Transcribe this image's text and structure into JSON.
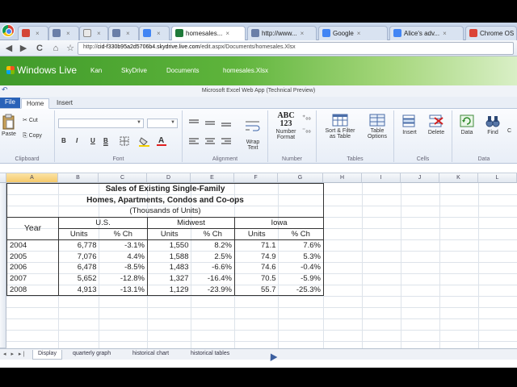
{
  "browser": {
    "tabs": [
      {
        "label": "",
        "color": "#d44638"
      },
      {
        "label": "",
        "color": "#6a7fa8"
      },
      {
        "label": "",
        "color": "#e9e9e9"
      },
      {
        "label": "",
        "color": "#6a7fa8"
      },
      {
        "label": "",
        "color": "#4285f4"
      },
      {
        "label": "homesales...",
        "color": "#1f7a3a"
      },
      {
        "label": "http://www...",
        "color": "#6a7fa8"
      },
      {
        "label": "Google",
        "color": "#4285f4"
      },
      {
        "label": "Alice's adv...",
        "color": "#4285f4"
      },
      {
        "label": "Chrome OS",
        "color": "#db4437"
      }
    ],
    "tab_close": "×",
    "back": "◀",
    "forward": "▶",
    "reload": "C",
    "home": "⌂",
    "star": "☆",
    "url_prefix": "http://",
    "url_domain": "cid-f330b95a2d5706b4.skydrive.live.com",
    "url_path": "/edit.aspx/Documents/homesales.Xlsx"
  },
  "live_header": {
    "brand": "Windows Live",
    "user": "Kan",
    "skydrive": "SkyDrive",
    "documents": "Documents",
    "file": "homesales.Xlsx"
  },
  "app_title": "Microsoft Excel Web App (Technical Preview)",
  "ribbon_tabs": {
    "file": "File",
    "home": "Home",
    "insert": "Insert"
  },
  "ribbon": {
    "paste": "Paste",
    "cut": "Cut",
    "copy": "Copy",
    "clipboard": "Clipboard",
    "font_group": "Font",
    "bold": "B",
    "italic": "I",
    "underline": "U",
    "dunderline": "B",
    "alignment": "Alignment",
    "wrap": "Wrap\nText",
    "number_format": "Number\nFormat",
    "number": "Number",
    "number_icon": "ABC\n123",
    "sort_filter": "Sort & Filter\nas Table",
    "table_options": "Table\nOptions",
    "tables": "Tables",
    "insert": "Insert",
    "delete": "Delete",
    "cells": "Cells",
    "data": "Data",
    "find": "Find",
    "data_group": "Data",
    "last": "C"
  },
  "columns": [
    "A",
    "B",
    "C",
    "D",
    "E",
    "F",
    "G",
    "H",
    "I",
    "J",
    "K",
    "L"
  ],
  "table": {
    "title1": "Sales of Existing Single-Family",
    "title2": "Homes, Apartments, Condos and Co-ops",
    "title3": "(Thousands of Units)",
    "year_label": "Year",
    "regions": [
      "U.S.",
      "Midwest",
      "Iowa"
    ],
    "units_label": "Units",
    "pct_label": "% Ch",
    "rows": [
      {
        "year": "2004",
        "us_units": "6,778",
        "us_pct": "-3.1%",
        "mw_units": "1,550",
        "mw_pct": "8.2%",
        "ia_units": "71.1",
        "ia_pct": "7.6%"
      },
      {
        "year": "2005",
        "us_units": "7,076",
        "us_pct": "4.4%",
        "mw_units": "1,588",
        "mw_pct": "2.5%",
        "ia_units": "74.9",
        "ia_pct": "5.3%"
      },
      {
        "year": "2006",
        "us_units": "6,478",
        "us_pct": "-8.5%",
        "mw_units": "1,483",
        "mw_pct": "-6.6%",
        "ia_units": "74.6",
        "ia_pct": "-0.4%"
      },
      {
        "year": "2007",
        "us_units": "5,652",
        "us_pct": "-12.8%",
        "mw_units": "1,327",
        "mw_pct": "-16.4%",
        "ia_units": "70.5",
        "ia_pct": "-5.9%"
      },
      {
        "year": "2008",
        "us_units": "4,913",
        "us_pct": "-13.1%",
        "mw_units": "1,129",
        "mw_pct": "-23.9%",
        "ia_units": "55.7",
        "ia_pct": "-25.3%"
      }
    ]
  },
  "sheets": [
    "Display",
    "quarterly graph",
    "historical chart",
    "historical tables"
  ],
  "sheet_nav": "◂ ▸ ▸|"
}
